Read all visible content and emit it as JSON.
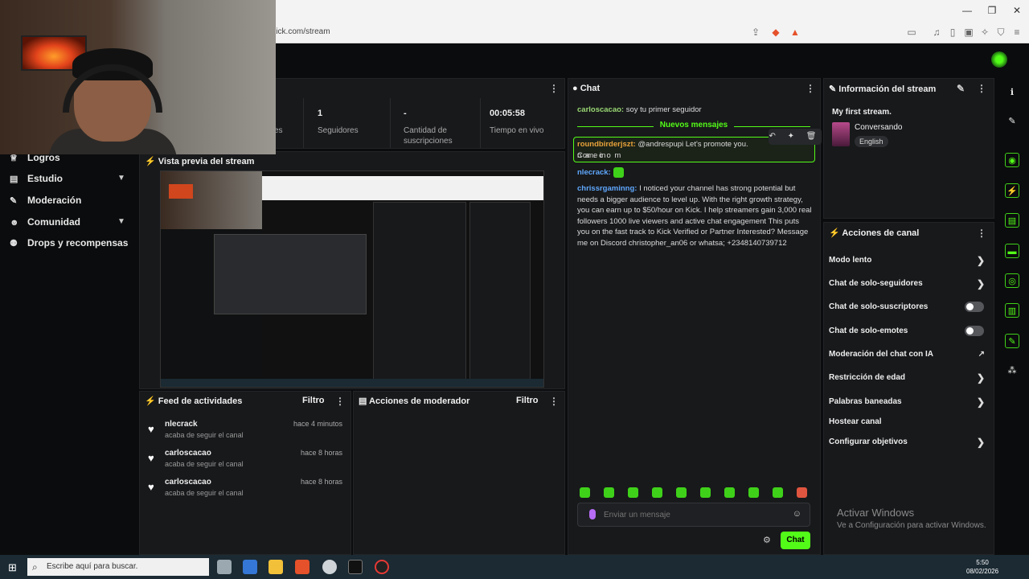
{
  "browser": {
    "url": "d.kick.com/stream",
    "win_min": "—",
    "win_max": "❐",
    "win_close": "✕"
  },
  "sidebar": {
    "items": [
      {
        "label": "Logros",
        "icon": "trophy-icon"
      },
      {
        "label": "Estudio",
        "icon": "studio-icon"
      },
      {
        "label": "Moderación",
        "icon": "wrench-icon"
      },
      {
        "label": "Comunidad",
        "icon": "community-icon"
      },
      {
        "label": "Drops y recompensas",
        "icon": "drops-icon"
      }
    ]
  },
  "stats": {
    "items": [
      {
        "value": "",
        "label": "es"
      },
      {
        "value": "1",
        "label": "Seguidores"
      },
      {
        "value": "-",
        "label": "Cantidad de suscripciones"
      },
      {
        "value": "00:05:58",
        "label": "Tiempo en vivo"
      }
    ]
  },
  "preview": {
    "title": "Vista previa del stream"
  },
  "feed": {
    "title": "Feed de actividades",
    "filter": "Filtro",
    "rows": [
      {
        "user": "nlecrack",
        "action": "acaba de seguir el canal",
        "time": "hace 4 minutos"
      },
      {
        "user": "carloscacao",
        "action": "acaba de seguir el canal",
        "time": "hace 8 horas"
      },
      {
        "user": "carloscacao",
        "action": "acaba de seguir el canal",
        "time": "hace 8 horas"
      }
    ]
  },
  "modactions": {
    "title": "Acciones de moderador",
    "filter": "Filtro"
  },
  "chat": {
    "title": "Chat",
    "msg1_user": "carloscacao:",
    "msg1_text": "soy tu primer seguidor",
    "new_messages": "Nuevos mensajes",
    "msg2_user": "roundbirderjszt:",
    "msg2_text": "@andrespupi Let's promote you. Come in",
    "msg2_text2": "n a . c o m",
    "msg3_user": "nlecrack:",
    "msg4_user": "chrissrgaminng:",
    "msg4_text": "I noticed your channel has strong potential but needs a bigger audience to level up. With the right growth strategy, you can earn up to $50/hour on Kick. I help streamers gain 3,000 real followers 1000 live viewers and active chat engagement This puts you on the fast track to Kick Verified or Partner Interested? Message me on Discord christopher_an06 or whatsa; +2348140739712",
    "input_placeholder": "Enviar un mensaje",
    "send": "Chat",
    "tools": "↶ ✦ 🗑"
  },
  "stream_info": {
    "title": "Información del stream",
    "stream_title": "My first stream.",
    "category": "Conversando",
    "language": "English"
  },
  "channel_actions": {
    "title": "Acciones de canal",
    "items": [
      {
        "label": "Modo lento",
        "control": "chevron"
      },
      {
        "label": "Chat de solo-seguidores",
        "control": "chevron"
      },
      {
        "label": "Chat de solo-suscriptores",
        "control": "toggle",
        "on": false
      },
      {
        "label": "Chat de solo-emotes",
        "control": "toggle",
        "on": false
      },
      {
        "label": "Moderación del chat con IA",
        "control": "external"
      },
      {
        "label": "Restricción de edad",
        "control": "chevron"
      },
      {
        "label": "Palabras baneadas",
        "control": "chevron"
      },
      {
        "label": "Hostear canal",
        "control": "none"
      },
      {
        "label": "Configurar objetivos",
        "control": "chevron"
      }
    ]
  },
  "windows": {
    "activate": "Activar Windows",
    "activate_sub": "Ve a Configuración para activar Windows."
  },
  "taskbar": {
    "search": "Escribe aquí para buscar.",
    "time": "5:50",
    "date": "08/02/2026"
  },
  "colors": {
    "accent": "#53fc18",
    "panel": "#18191b",
    "bg": "#0b0c0d"
  }
}
